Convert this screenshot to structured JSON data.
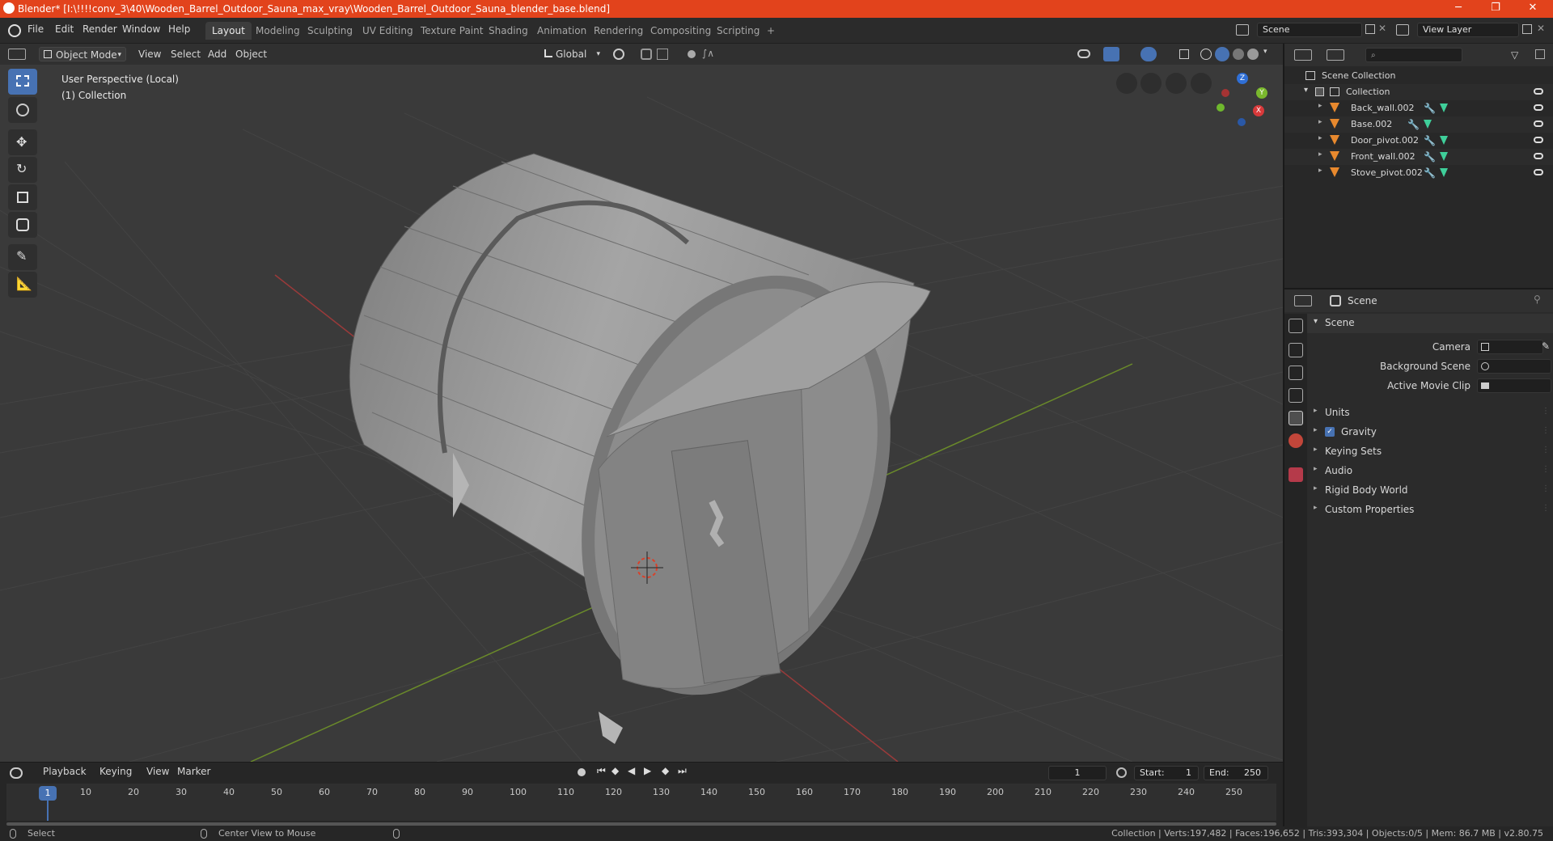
{
  "window": {
    "title": "Blender* [I:\\!!!!conv_3\\40\\Wooden_Barrel_Outdoor_Sauna_max_vray\\Wooden_Barrel_Outdoor_Sauna_blender_base.blend]",
    "minimize": "─",
    "maximize": "❐",
    "close": "✕"
  },
  "menu": [
    "File",
    "Edit",
    "Render",
    "Window",
    "Help"
  ],
  "workspaces": [
    "Layout",
    "Modeling",
    "Sculpting",
    "UV Editing",
    "Texture Paint",
    "Shading",
    "Animation",
    "Rendering",
    "Compositing",
    "Scripting"
  ],
  "active_workspace": "Layout",
  "add_workspace": "+",
  "scene_field": "Scene",
  "view_layer_field": "View Layer",
  "viewport_header": {
    "mode": "Object Mode",
    "menus": [
      "View",
      "Select",
      "Add",
      "Object"
    ],
    "orientation": "Global"
  },
  "viewport": {
    "perspective": "User Perspective (Local)",
    "collection": "(1) Collection",
    "gizmo_axes": {
      "x": "X",
      "y": "Y",
      "z": "Z"
    }
  },
  "timeline": {
    "menus": [
      "Playback",
      "Keying",
      "View",
      "Marker"
    ],
    "current_frame": "1",
    "start_label": "Start:",
    "start": "1",
    "end_label": "End:",
    "end": "250",
    "ruler": [
      "1",
      "10",
      "20",
      "30",
      "40",
      "50",
      "60",
      "70",
      "80",
      "90",
      "100",
      "110",
      "120",
      "130",
      "140",
      "150",
      "160",
      "170",
      "180",
      "190",
      "200",
      "210",
      "220",
      "230",
      "240",
      "250"
    ]
  },
  "status": {
    "left": "Select",
    "middle": "Center View to Mouse",
    "right": "Collection | Verts:197,482 | Faces:196,652 | Tris:393,304 | Objects:0/5 | Mem: 86.7 MB | v2.80.75"
  },
  "outliner": {
    "root": "Scene Collection",
    "collection": "Collection",
    "objects": [
      "Back_wall.002",
      "Base.002",
      "Door_pivot.002",
      "Front_wall.002",
      "Stove_pivot.002"
    ]
  },
  "properties": {
    "header": "Scene",
    "panel_title": "Scene",
    "camera_label": "Camera",
    "background_scene_label": "Background Scene",
    "active_movie_clip_label": "Active Movie Clip",
    "sections": [
      "Units",
      "Gravity",
      "Keying Sets",
      "Audio",
      "Rigid Body World",
      "Custom Properties"
    ]
  },
  "colors": {
    "accent": "#4772b3",
    "titlebar": "#e2431c",
    "object_icon": "#e8892e",
    "modifier_icon": "#5fa4e8",
    "mesh_icon": "#3fcf9a"
  }
}
